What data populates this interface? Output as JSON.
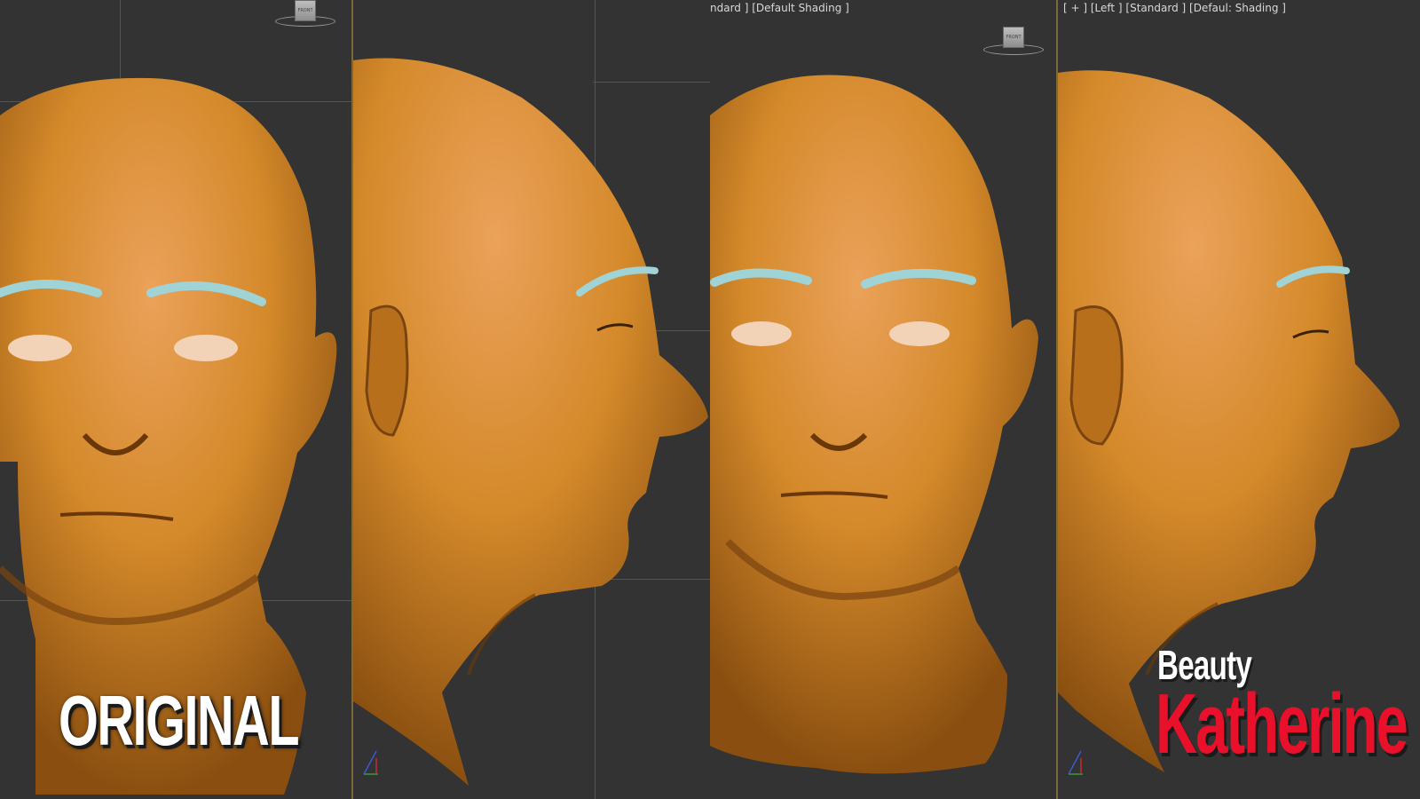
{
  "viewports": [
    {
      "id": "front-original",
      "label": ""
    },
    {
      "id": "left-original",
      "label": ""
    },
    {
      "id": "front-beauty",
      "label": "ndard ] [Default Shading ]"
    },
    {
      "id": "left-beauty",
      "label": "[ + ] [Left ] [Standard ] [Defaul: Shading ]"
    }
  ],
  "viewcube": {
    "face_label": "FRONT"
  },
  "titles": {
    "original": "ORIGINAL",
    "beauty": "Beauty",
    "name": "Katherine"
  },
  "colors": {
    "skin": "#d4892a",
    "viewport_bg": "#333333",
    "eyebrow": "#9fd3d6",
    "name_red": "#e8102a"
  }
}
